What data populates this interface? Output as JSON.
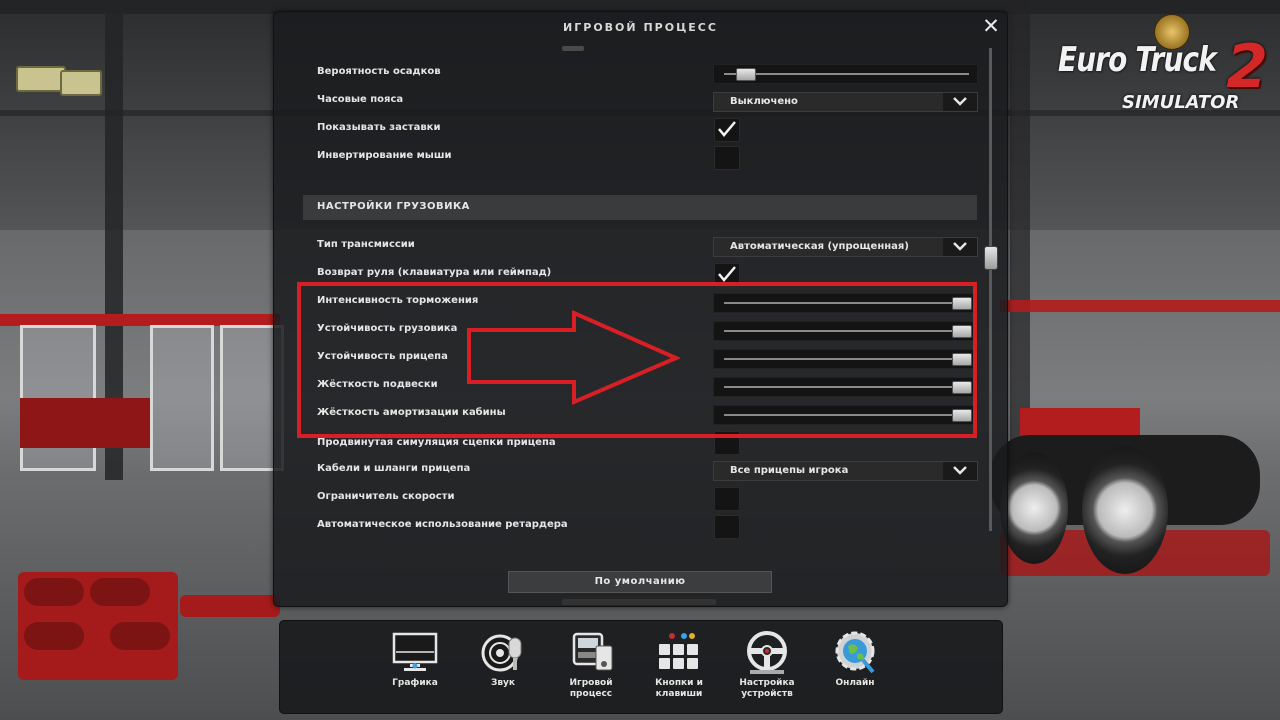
{
  "dialog": {
    "title": "ИГРОВОЙ ПРОЦЕСС",
    "close": "✕",
    "default_button": "По умолчанию"
  },
  "logo": {
    "line1": "Euro Truck",
    "number": "2",
    "line2": "SIMULATOR"
  },
  "rows": {
    "rain_probability": {
      "label": "Вероятность осадков",
      "value": 0.1
    },
    "time_zones": {
      "label": "Часовые пояса",
      "value": "Выключено"
    },
    "show_intro": {
      "label": "Показывать заставки",
      "checked": true
    },
    "invert_mouse": {
      "label": "Инвертирование мыши",
      "checked": false
    },
    "truck_section": {
      "label": "НАСТРОЙКИ ГРУЗОВИКА"
    },
    "transmission": {
      "label": "Тип трансмиссии",
      "value": "Автоматическая (упрощенная)"
    },
    "steering_return": {
      "label": "Возврат руля (клавиатура или геймпад)",
      "checked": true
    },
    "brake_intensity": {
      "label": "Интенсивность торможения",
      "value": 1.0
    },
    "truck_stability": {
      "label": "Устойчивость грузовика",
      "value": 1.0
    },
    "trailer_stability": {
      "label": "Устойчивость прицепа",
      "value": 1.0
    },
    "suspension_stiffness": {
      "label": "Жёсткость подвески",
      "value": 1.0
    },
    "cabin_stiffness": {
      "label": "Жёсткость амортизации кабины",
      "value": 1.0
    },
    "advanced_coupling": {
      "label": "Продвинутая симуляция сцепки прицепа",
      "checked": false
    },
    "trailer_cables": {
      "label": "Кабели и шланги прицепа",
      "value": "Все прицепы игрока"
    },
    "speed_limiter": {
      "label": "Ограничитель скорости",
      "checked": false
    },
    "auto_retarder": {
      "label": "Автоматическое использование ретардера",
      "checked": false
    }
  },
  "toolbar": {
    "graphics": "Графика",
    "sound": "Звук",
    "gameplay_1": "Игровой",
    "gameplay_2": "процесс",
    "keys_1": "Кнопки и",
    "keys_2": "клавиши",
    "devices_1": "Настройка",
    "devices_2": "устройств",
    "online": "Онлайн"
  },
  "colors": {
    "highlight": "#d81f26",
    "panel": "#1a1b1d"
  }
}
